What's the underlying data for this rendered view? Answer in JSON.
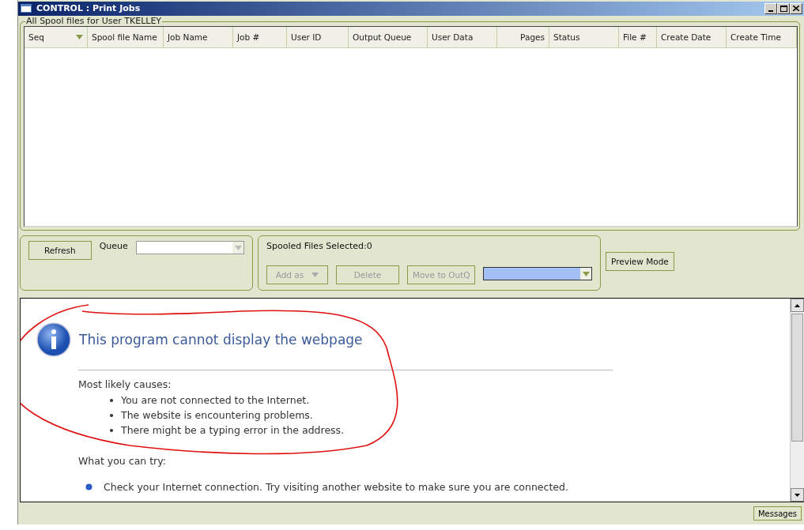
{
  "window": {
    "title": "CONTROL : Print Jobs"
  },
  "spool_group": {
    "title": "All Spool files for User TKELLEY",
    "columns": [
      {
        "label": "Seq",
        "sorted": true,
        "kind": "text"
      },
      {
        "label": "Spool file Name",
        "sorted": false,
        "kind": "text"
      },
      {
        "label": "Job Name",
        "sorted": false,
        "kind": "text"
      },
      {
        "label": "Job #",
        "sorted": false,
        "kind": "text"
      },
      {
        "label": "User ID",
        "sorted": false,
        "kind": "text"
      },
      {
        "label": "Output Queue",
        "sorted": false,
        "kind": "text"
      },
      {
        "label": "User Data",
        "sorted": false,
        "kind": "text"
      },
      {
        "label": "Pages",
        "sorted": false,
        "kind": "number"
      },
      {
        "label": "Status",
        "sorted": false,
        "kind": "text"
      },
      {
        "label": "File #",
        "sorted": false,
        "kind": "text"
      },
      {
        "label": "Create Date",
        "sorted": false,
        "kind": "text"
      },
      {
        "label": "Create Time",
        "sorted": false,
        "kind": "text"
      }
    ]
  },
  "queue_panel": {
    "refresh": "Refresh",
    "queue_label": "Queue"
  },
  "selection_panel": {
    "selected_label": "Spooled Files Selected:0",
    "buttons": [
      {
        "label": "Add as",
        "disabled": true,
        "dropdown": true
      },
      {
        "label": "Delete",
        "disabled": true,
        "dropdown": false
      },
      {
        "label": "Move to OutQ",
        "disabled": true,
        "dropdown": false
      }
    ]
  },
  "preview_button": "Preview Mode",
  "browser": {
    "title": "This program cannot display the webpage",
    "causes_heading": "Most likely causes:",
    "causes": [
      "You are not connected to the Internet.",
      "The website is encountering problems.",
      "There might be a typing error in the address."
    ],
    "try_heading": "What you can try:",
    "tries": [
      "Check your Internet connection. Try visiting another website to make sure you are connected."
    ]
  },
  "status_bar": {
    "messages": "Messages"
  }
}
